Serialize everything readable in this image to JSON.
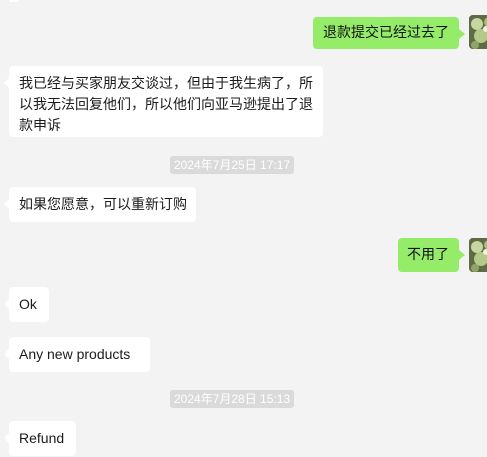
{
  "messages": [
    {
      "id": "m1",
      "side": "out",
      "text": "退款提交已经过去了"
    },
    {
      "id": "m2",
      "side": "in",
      "text": "我已经与买家朋友交谈过，但由于我生病了，所以我无法回复他们，所以他们向亚马逊提出了退款申诉"
    },
    {
      "id": "m3",
      "side": "in",
      "text": "如果您愿意，可以重新订购"
    },
    {
      "id": "m4",
      "side": "out",
      "text": "不用了"
    },
    {
      "id": "m5",
      "side": "in",
      "text": "Ok"
    },
    {
      "id": "m6",
      "side": "in",
      "text": "Any new products"
    },
    {
      "id": "m7",
      "side": "in",
      "text": "Refund"
    }
  ],
  "timestamps": {
    "t1": "2024年7月25日 17:17",
    "t2": "2024年7月28日 15:13"
  },
  "colors": {
    "background": "#f3f3f3",
    "outgoing_bubble": "#95ec69",
    "incoming_bubble": "#ffffff",
    "timestamp_pill": "#dadada"
  },
  "icons": {
    "self_avatar": "succulent-plant-avatar-icon"
  }
}
